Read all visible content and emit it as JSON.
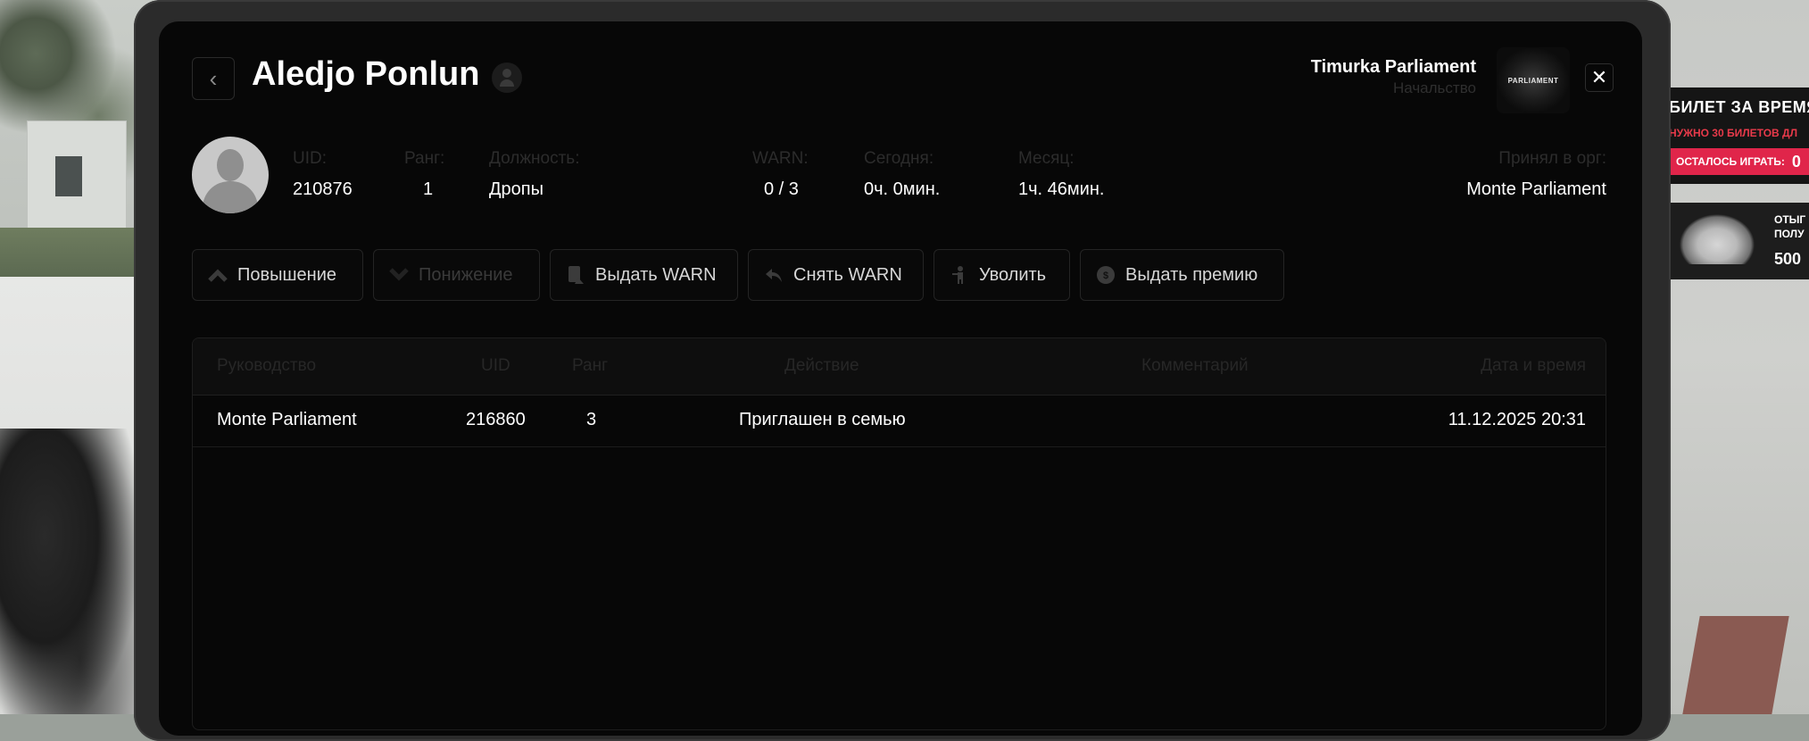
{
  "player": {
    "name": "Aledjo Ponlun",
    "uid_label": "UID:",
    "uid": "210876",
    "rank_label": "Ранг:",
    "rank": "1",
    "position_label": "Должность:",
    "position": "Дропы",
    "warn_label": "WARN:",
    "warn": "0 / 3",
    "today_label": "Сегодня:",
    "today": "0ч. 0мин.",
    "month_label": "Месяц:",
    "month": "1ч. 46мин.",
    "accepted_label": "Принял в орг:",
    "accepted_by": "Monte Parliament"
  },
  "org": {
    "name": "Timurka Parliament",
    "role": "Начальство",
    "logo_text": "PARLIAMENT"
  },
  "actions": [
    {
      "label": "Повышение",
      "icon": "chevron-up-icon",
      "enabled": true
    },
    {
      "label": "Понижение",
      "icon": "chevron-down-icon",
      "enabled": false
    },
    {
      "label": "Выдать WARN",
      "icon": "warn-document-icon",
      "enabled": true
    },
    {
      "label": "Снять WARN",
      "icon": "undo-arrow-icon",
      "enabled": true
    },
    {
      "label": "Уволить",
      "icon": "fire-person-icon",
      "enabled": true
    },
    {
      "label": "Выдать премию",
      "icon": "coin-icon",
      "enabled": true
    }
  ],
  "table": {
    "headers": {
      "leader": "Руководство",
      "uid": "UID",
      "rank": "Ранг",
      "action": "Действие",
      "comment": "Комментарий",
      "datetime": "Дата и время"
    },
    "rows": [
      {
        "leader": "Monte Parliament",
        "uid": "216860",
        "rank": "3",
        "action": "Приглашен в семью",
        "comment": "",
        "datetime": "11.12.2025 20:31"
      }
    ]
  },
  "side_widget": {
    "title": "БИЛЕТ ЗА ВРЕМЯ",
    "subtitle": "НУЖНО 30 БИЛЕТОВ ДЛ",
    "remaining_label": "ОСТАЛОСЬ ИГРАТЬ:",
    "remaining_value": "0",
    "reward_line1": "ОТЫГ",
    "reward_line2": "ПОЛУ",
    "reward_value": "500"
  },
  "colors": {
    "panel_bg": "#070707",
    "accent_pink": "#e0254a",
    "muted_label": "#2c2c2c"
  }
}
